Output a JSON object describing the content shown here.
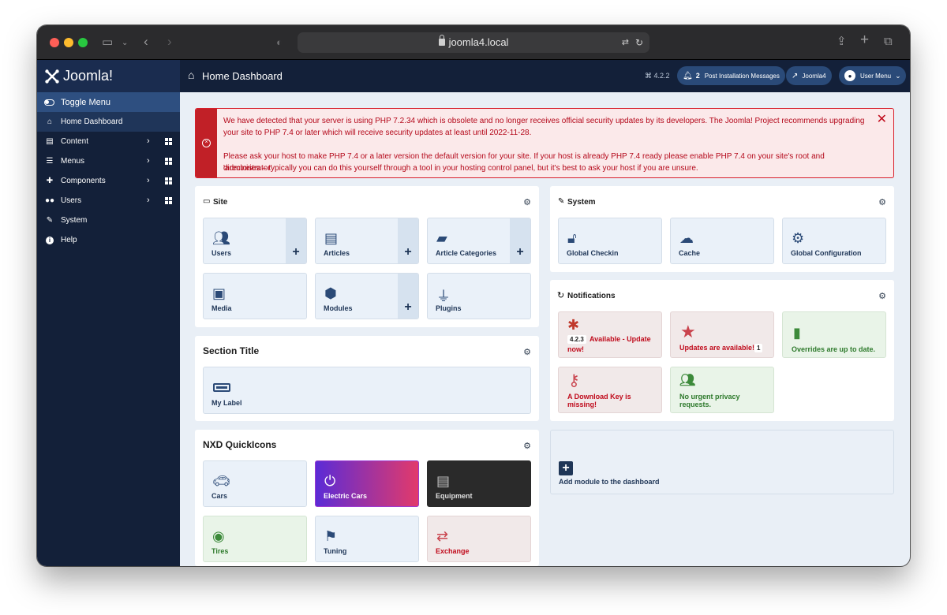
{
  "browser": {
    "url": "joomla4.local"
  },
  "brand": {
    "name": "Joomla!"
  },
  "sidebar": {
    "toggle_label": "Toggle Menu",
    "items": [
      {
        "label": "Home Dashboard"
      },
      {
        "label": "Content"
      },
      {
        "label": "Menus"
      },
      {
        "label": "Components"
      },
      {
        "label": "Users"
      },
      {
        "label": "System"
      },
      {
        "label": "Help"
      }
    ]
  },
  "header": {
    "title": "Home Dashboard",
    "version": "⌘ 4.2.2",
    "messages_count": "2",
    "messages_label": "Post Installation Messages",
    "site_label": "Joomla4",
    "user_menu_label": "User Menu"
  },
  "alert": {
    "line1": "We have detected that your server is using PHP 7.2.34 which is obsolete and no longer receives official security updates by its developers. The Joomla! Project recommends upgrading",
    "line2": "your site to PHP 7.4 or later which will receive security updates at least until 2022-11-28.",
    "line3": "Please ask your host to make PHP 7.4 or a later version the default version for your site. If your host is already PHP 7.4 ready please enable PHP 7.4 on your site's root and 'administrator'",
    "line4": "directories – typically you can do this yourself through a tool in your hosting control panel, but it's best to ask your host if you are unsure."
  },
  "site": {
    "title": "Site",
    "tiles": [
      {
        "label": "Users"
      },
      {
        "label": "Articles"
      },
      {
        "label": "Article Categories"
      },
      {
        "label": "Media"
      },
      {
        "label": "Modules"
      },
      {
        "label": "Plugins"
      }
    ]
  },
  "system": {
    "title": "System",
    "tiles": [
      {
        "label": "Global Checkin"
      },
      {
        "label": "Cache"
      },
      {
        "label": "Global Configuration"
      }
    ]
  },
  "notifications": {
    "title": "Notifications",
    "update_version": "4.2.3",
    "update_text": "Available - Update",
    "update_text2": "now!",
    "updates_text": "Updates are available!",
    "updates_count": "1",
    "overrides_text": "Overrides are up to date.",
    "key_text": "A Download Key is",
    "key_text2": "missing!",
    "privacy_text": "No urgent privacy",
    "privacy_text2": "requests."
  },
  "section": {
    "title": "Section Title",
    "tile_label": "My Label"
  },
  "add_module": {
    "label": "Add module to the dashboard"
  },
  "nxd": {
    "title": "NXD QuickIcons",
    "tiles": [
      {
        "label": "Cars"
      },
      {
        "label": "Electric Cars"
      },
      {
        "label": "Equipment"
      },
      {
        "label": "Tires"
      },
      {
        "label": "Tuning"
      },
      {
        "label": "Exchange"
      }
    ]
  },
  "colors": {
    "sidebar": "#132039",
    "accent": "#2e4f80",
    "alert_text": "#b4081a"
  }
}
